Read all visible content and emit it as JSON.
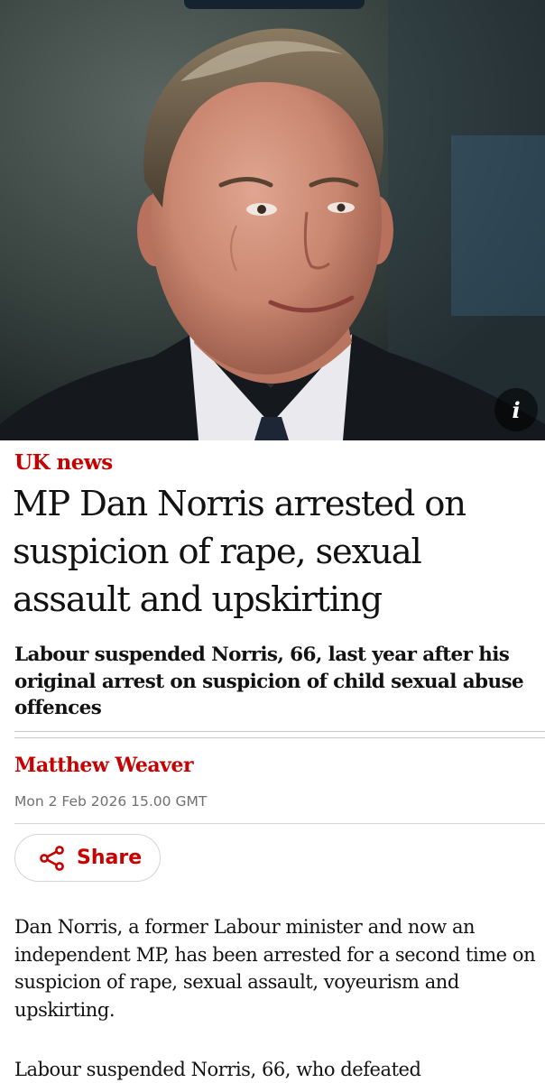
{
  "hero": {
    "info_icon": "info-icon",
    "info_glyph": "i"
  },
  "article": {
    "section": "UK news",
    "headline": "MP Dan Norris arrested on suspicion of rape, sexual assault and upskirting",
    "standfirst": "Labour suspended Norris, 66, last year after his original arrest on suspicion of child sexual abuse offences",
    "author": "Matthew Weaver",
    "date": "Mon 2 Feb 2026 15.00 GMT",
    "share_label": "Share",
    "share_icon": "share-icon",
    "paragraphs": [
      "Dan Norris, a former Labour minister and now an independent MP, has been arrested for a second time on suspicion of rape, sexual assault, voyeurism and upskirting.",
      "Labour suspended Norris, 66, who defeated"
    ]
  },
  "colors": {
    "accent": "#c70000",
    "text": "#121212",
    "meta": "#707070"
  }
}
